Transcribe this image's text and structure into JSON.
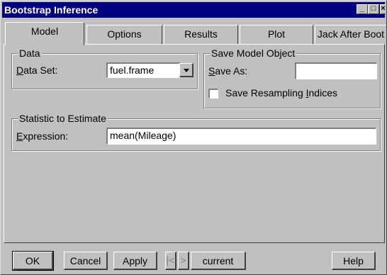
{
  "window": {
    "title": "Bootstrap Inference"
  },
  "tabs": [
    {
      "label": "Model"
    },
    {
      "label": "Options"
    },
    {
      "label": "Results"
    },
    {
      "label": "Plot"
    },
    {
      "label": "Jack After Boot"
    }
  ],
  "data_group": {
    "legend": "Data",
    "dataset_label_prefix": "D",
    "dataset_label_rest": "ata Set:",
    "dataset_value": "fuel.frame"
  },
  "save_group": {
    "legend": "Save Model Object",
    "save_as_prefix": "S",
    "save_as_rest": "ave As:",
    "save_as_value": "",
    "checkbox_label_a": "Save Resampling ",
    "checkbox_label_u": "I",
    "checkbox_label_b": "ndices",
    "checkbox_checked": false
  },
  "stat_group": {
    "legend": "Statistic to Estimate",
    "expr_prefix": "E",
    "expr_rest": "xpression:",
    "expr_value": "mean(Mileage)"
  },
  "footer": {
    "ok": "OK",
    "cancel": "Cancel",
    "apply": "Apply",
    "current": "current",
    "help": "Help"
  }
}
